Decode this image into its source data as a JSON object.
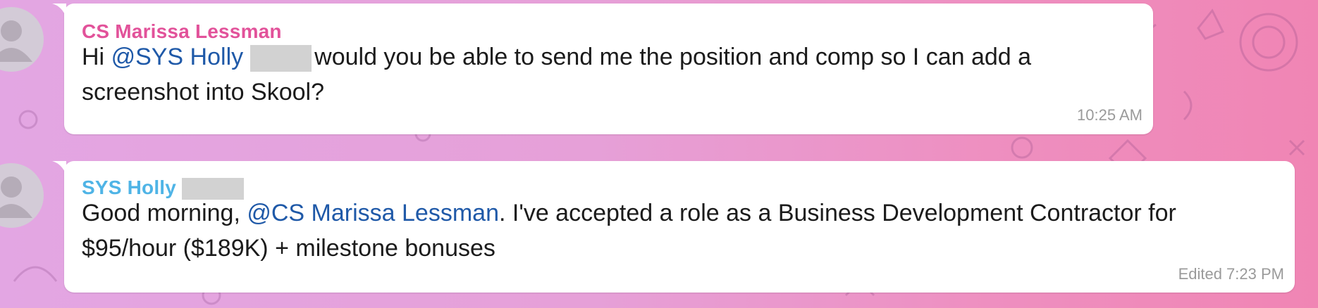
{
  "messages": [
    {
      "sender": "CS Marissa Lessman",
      "sender_color": "#e2529a",
      "text_pre": "Hi ",
      "mention": "@SYS Holly",
      "text_post": "would you be able to send me the position and comp so I can add a",
      "text_line2": "screenshot into Skool?",
      "time": "10:25 AM"
    },
    {
      "sender": "SYS Holly",
      "sender_color": "#4fb4e6",
      "text_pre": "Good morning, ",
      "mention": "@CS Marissa Lessman",
      "text_post": ". I've accepted a role as a Business Development Contractor for",
      "text_line2": "$95/hour ($189K) + milestone bonuses",
      "time": "Edited 7:23 PM"
    }
  ],
  "colors": {
    "mention": "#1f59a8",
    "bubble": "#ffffff",
    "redaction": "#d2d2d2"
  },
  "icons": {
    "avatar": "person-silhouette-icon"
  }
}
